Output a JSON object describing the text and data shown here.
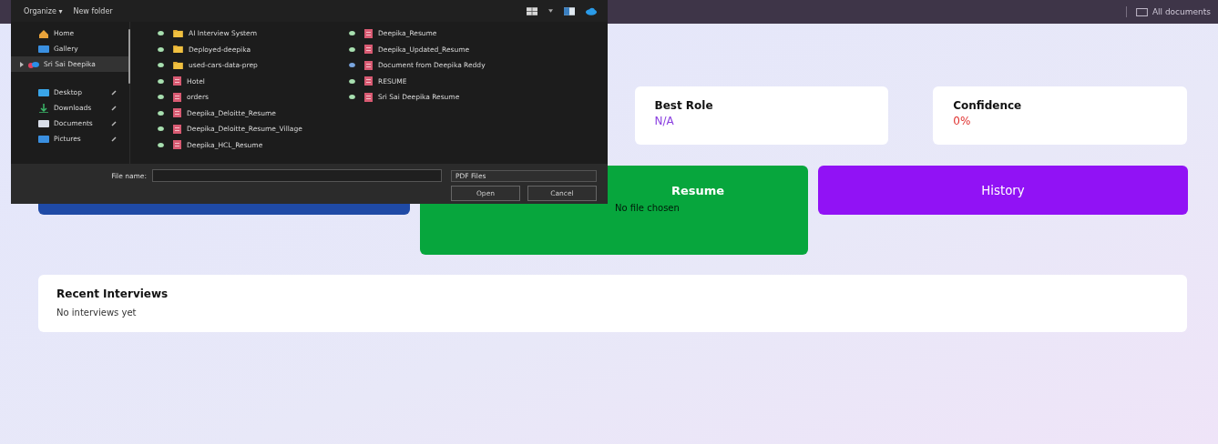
{
  "topbar": {
    "documents_label": "All documents"
  },
  "stats": [
    {
      "label": "Best Role",
      "value": "N/A",
      "color": "#8a3ee0"
    },
    {
      "label": "Confidence",
      "value": "0%",
      "color": "#e0312f"
    }
  ],
  "actions": [
    {
      "color": "#1f4aa6"
    },
    {
      "label": "Resume",
      "note": "No file chosen",
      "color": "#07a63d"
    },
    {
      "label": "History",
      "color": "#9112f5"
    }
  ],
  "recent": {
    "title": "Recent Interviews",
    "empty_text": "No interviews yet"
  },
  "dialog": {
    "toolbar": {
      "organize": "Organize ▾",
      "new_folder": "New folder"
    },
    "sidebar": [
      {
        "label": "Home",
        "selected": false,
        "pinned": false
      },
      {
        "label": "Gallery",
        "selected": false,
        "pinned": false
      },
      {
        "label": "Sri Sai Deepika",
        "selected": true,
        "pinned": false
      },
      {
        "label": "Desktop",
        "selected": false,
        "pinned": true
      },
      {
        "label": "Downloads",
        "selected": false,
        "pinned": true
      },
      {
        "label": "Documents",
        "selected": false,
        "pinned": true
      },
      {
        "label": "Pictures",
        "selected": false,
        "pinned": true
      }
    ],
    "files": [
      {
        "name": "AI Interview System",
        "kind": "folder",
        "on_device": true
      },
      {
        "name": "Deployed-deepika",
        "kind": "folder",
        "on_device": true
      },
      {
        "name": "used-cars-data-prep",
        "kind": "folder",
        "on_device": true
      },
      {
        "name": "Hotel",
        "kind": "pdf",
        "on_device": true
      },
      {
        "name": "orders",
        "kind": "pdf",
        "on_device": true
      },
      {
        "name": "Deepika_Deloitte_Resume",
        "kind": "pdf",
        "on_device": true
      },
      {
        "name": "Deepika_Deloitte_Resume_Village",
        "kind": "pdf",
        "on_device": true
      },
      {
        "name": "Deepika_HCL_Resume",
        "kind": "pdf",
        "on_device": true
      },
      {
        "name": "Deepika_Resume",
        "kind": "pdf",
        "on_device": true
      },
      {
        "name": "Deepika_Updated_Resume",
        "kind": "pdf",
        "on_device": true
      },
      {
        "name": "Document from Deepika Reddy",
        "kind": "pdf",
        "on_device": false
      },
      {
        "name": "RESUME",
        "kind": "pdf",
        "on_device": true
      },
      {
        "name": "Sri Sai Deepika Resume",
        "kind": "pdf",
        "on_device": true
      }
    ],
    "file_name_label": "File name:",
    "file_type": "PDF Files",
    "buttons": [
      "Open",
      "Cancel"
    ]
  }
}
